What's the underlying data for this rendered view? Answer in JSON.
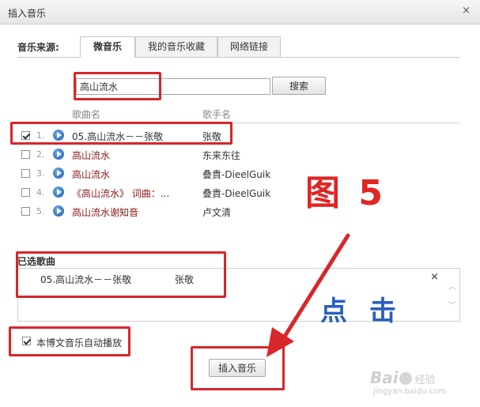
{
  "dialog": {
    "title": "插入音乐",
    "close_symbol": "×"
  },
  "source": {
    "label": "音乐来源:",
    "tabs": [
      {
        "label": "微音乐",
        "active": true
      },
      {
        "label": "我的音乐收藏",
        "active": false
      },
      {
        "label": "网络链接",
        "active": false
      }
    ]
  },
  "search": {
    "value": "高山流水",
    "button_label": "搜索"
  },
  "list": {
    "headers": {
      "song": "歌曲名",
      "singer": "歌手名"
    },
    "rows": [
      {
        "index": "1.",
        "song": "05.高山流水－－张敬",
        "singer": "张敬",
        "checked": true
      },
      {
        "index": "2.",
        "song": "高山流水",
        "singer": "东来东往",
        "checked": false
      },
      {
        "index": "3.",
        "song": "高山流水",
        "singer": "叠貴-DieelGuik",
        "checked": false
      },
      {
        "index": "4.",
        "song": "《高山流水》 词曲：...",
        "singer": "叠貴-DieelGuik",
        "checked": false
      },
      {
        "index": "5.",
        "song": "高山流水谢知音",
        "singer": "卢文清",
        "checked": false
      }
    ]
  },
  "selected": {
    "title": "已选歌曲",
    "items": [
      {
        "song": "05.高山流水－－张敬",
        "singer": "张敬"
      }
    ],
    "remove_symbol": "×",
    "scroll_up_symbol": "︿",
    "scroll_down_symbol": "﹀"
  },
  "autoplay": {
    "label": "本博文音乐自动播放",
    "checked": true
  },
  "insert_button": {
    "label": "插入音乐"
  },
  "annotations": {
    "figure_label": "图 5",
    "click_label": "点 击",
    "color_red": "#d8262a",
    "color_blue": "#2a5fc0"
  },
  "watermark": {
    "brand_a": "Bai",
    "brand_b": "经验",
    "url": "jingyan.baidu.com"
  }
}
